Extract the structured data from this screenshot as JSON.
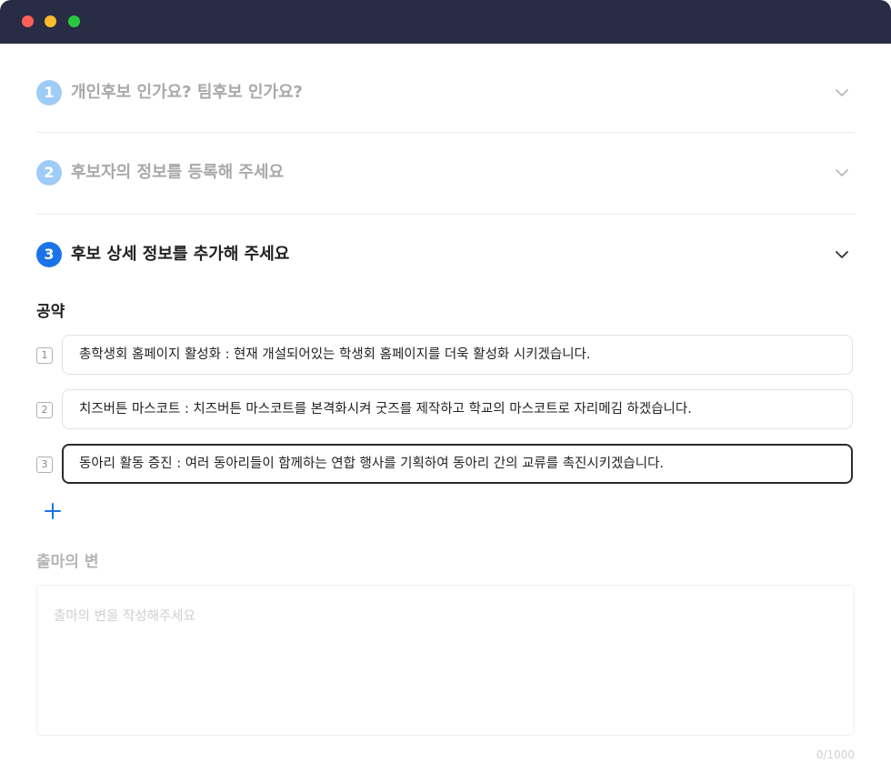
{
  "window": {
    "controls": [
      "close",
      "minimize",
      "maximize"
    ]
  },
  "steps": [
    {
      "number": "1",
      "title": "개인후보 인가요? 팀후보 인가요?",
      "state": "inactive"
    },
    {
      "number": "2",
      "title": "후보자의 정보를 등록해 주세요",
      "state": "inactive"
    },
    {
      "number": "3",
      "title": "후보 상세 정보를 추가해 주세요",
      "state": "active"
    }
  ],
  "pledges": {
    "label": "공약",
    "items": [
      {
        "index": "1",
        "value": "총학생회 홈페이지 활성화 : 현재 개설되어있는 학생회 홈페이지를 더욱 활성화 시키겠습니다."
      },
      {
        "index": "2",
        "value": "치즈버튼 마스코트 : 치즈버튼 마스코트를 본격화시켜 굿즈를 제작하고 학교의 마스코트로 자리메김 하겠습니다."
      },
      {
        "index": "3",
        "value": "동아리 활동 증진 : 여러 동아리들이 함께하는 연합 행사를 기획하여 동아리 간의 교류를 촉진시키겠습니다."
      }
    ],
    "add_icon": "plus-icon"
  },
  "speech": {
    "label": "출마의 변",
    "placeholder": "출마의 변을 작성해주세요",
    "value": "",
    "counter": "0/1000"
  },
  "colors": {
    "titlebar": "#282c44",
    "accent": "#1a73e8",
    "inactive_badge": "#9fccf7"
  }
}
